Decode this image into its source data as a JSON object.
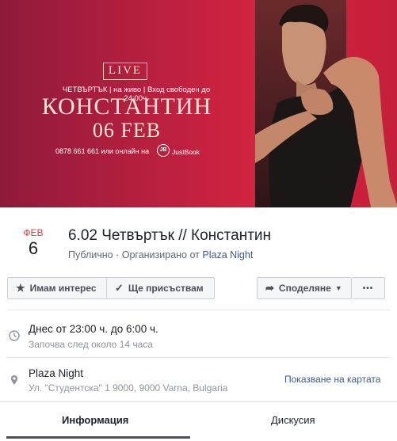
{
  "cover": {
    "live": "LIVE",
    "line1": "ЧЕТВЪРТЪК | на живо | Вход свободен до 24:00ч.",
    "name": "КОНСТАНТИН",
    "date": "06 FEB",
    "contact": "0878 661 661 или онлайн на",
    "justbook_mark": "JB",
    "justbook": "JustBook"
  },
  "event": {
    "month": "ФЕВ",
    "day": "6",
    "title": "6.02 Четвъртък // Константин",
    "visibility": "Публично",
    "separator": " · ",
    "organized_by": "Организирано от",
    "organizer": "Plaza Night"
  },
  "actions": {
    "interested": "Имам интерес",
    "going": "Ще присъствам",
    "share": "Споделяне",
    "more": "•••"
  },
  "details": {
    "time_main": "Днес от 23:00 ч. до 6:00 ч.",
    "time_sub": "Започва след около 14 часа",
    "place_main": "Plaza Night",
    "place_sub": "Ул. \"Студентска\" 1 9000, 9000 Varna, Bulgaria",
    "map_link": "Показване на картата"
  },
  "tabs": {
    "info": "Информация",
    "discussion": "Дискусия"
  },
  "colors": {
    "accent": "#385898",
    "month": "#e0393e",
    "cover": "#c41f3b"
  }
}
